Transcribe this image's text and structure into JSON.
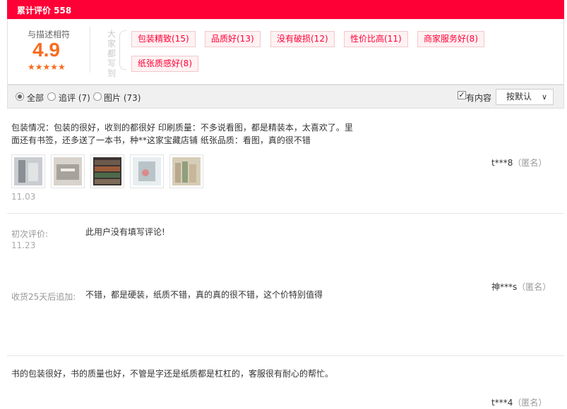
{
  "header": {
    "title": "累计评价 558"
  },
  "summary": {
    "score_label": "与描述相符",
    "score": "4.9",
    "stars": "★★★★★",
    "everyone_said": "大家都写到",
    "tags": [
      {
        "label": "包装精致(15)"
      },
      {
        "label": "品质好(13)"
      },
      {
        "label": "没有破损(12)"
      },
      {
        "label": "性价比高(11)"
      },
      {
        "label": "商家服务好(8)"
      },
      {
        "label": "纸张质感好(8)"
      }
    ]
  },
  "filters": {
    "all": "全部",
    "followup": "追评 (7)",
    "pictures": "图片 (73)",
    "has_content": "有内容",
    "sort": "按默认",
    "sort_caret": "∨"
  },
  "reviews": [
    {
      "text_line1": "包装情况：包装的很好，收到的都很好 印刷质量：不多说看图，都是精装本，太喜欢了。里",
      "text_line2": "面还有书签，还多送了一本书，种**这家宝藏店铺 纸张品质：看图，真的很不错",
      "date": "11.03",
      "user": "t***8",
      "anon": "（匿名）",
      "thumb_colors": [
        "#8a8f95",
        "#a7a29c",
        "#6c5a4c",
        "#b9c4c8",
        "#b8a88c"
      ]
    },
    {
      "initial_label": "初次评价:",
      "initial_text": "此用户没有填写评论!",
      "initial_date": "11.23",
      "user": "神***s",
      "anon": "（匿名）",
      "followup_label": "收货25天后追加:",
      "followup_text": "不错，都是硬装，纸质不错，真的真的很不错，这个价特别值得"
    },
    {
      "text": "书的包装很好，书的质量也好，不管是字还是纸质都是杠杠的，客服很有耐心的帮忙。",
      "user": "t***4",
      "anon": "（匿名）"
    }
  ]
}
